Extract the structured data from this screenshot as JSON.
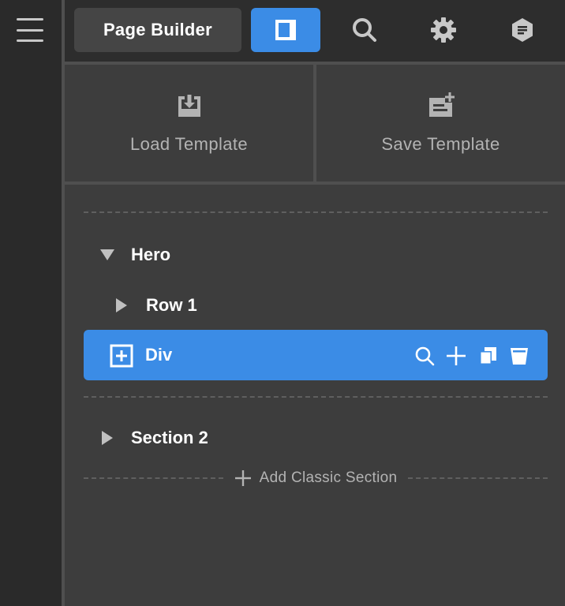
{
  "topbar": {
    "title": "Page Builder",
    "icons": [
      "layout-panel-icon",
      "search-icon",
      "settings-gear-icon",
      "info-hexagon-icon"
    ]
  },
  "templates": {
    "load_label": "Load Template",
    "save_label": "Save Template"
  },
  "tree": {
    "items": [
      {
        "label": "Hero",
        "state": "expanded"
      },
      {
        "label": "Row 1",
        "state": "collapsed"
      },
      {
        "label": "Div",
        "state": "selected"
      },
      {
        "label": "Section 2",
        "state": "collapsed"
      }
    ],
    "selected_actions": [
      "search-icon",
      "add-icon",
      "duplicate-icon",
      "delete-icon"
    ]
  },
  "footer": {
    "add_section_label": "Add Classic Section"
  },
  "colors": {
    "accent": "#3b8ce6",
    "background": "#3d3d3d",
    "sidebar": "#2a2a2a",
    "topbar": "#2d2d2d",
    "muted_text": "#b3b3b3"
  }
}
